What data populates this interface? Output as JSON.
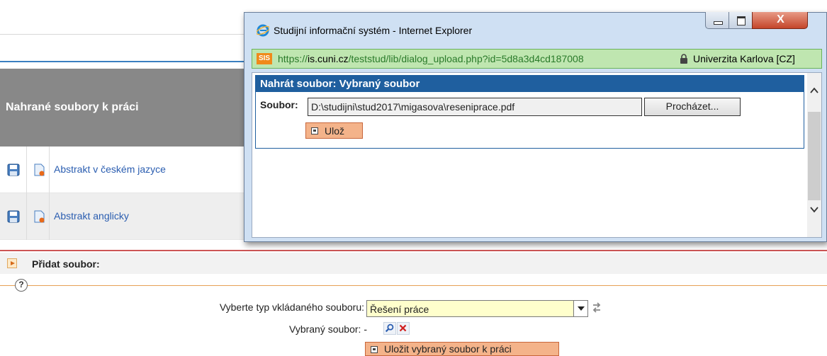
{
  "background": {
    "table_header": "Nahrané soubory k práci",
    "rows": [
      {
        "label": "Abstrakt v českém jazyce"
      },
      {
        "label": "Abstrakt anglicky"
      }
    ],
    "add_section": {
      "title": "Přidat soubor:",
      "help_symbol": "?"
    },
    "form": {
      "type_label": "Vyberte typ vkládaného souboru:",
      "type_value": "Řešení práce",
      "selected_label": "Vybraný soubor:",
      "selected_value": "-",
      "save_button": "Uložit vybraný soubor k práci"
    }
  },
  "popup": {
    "window_title": "Studijní informační systém - Internet Explorer",
    "close_symbol": "X",
    "address": {
      "badge": "SIS",
      "protocol": "https://",
      "domain": "is.cuni.cz",
      "path": "/teststud/lib/dialog_upload.php?id=5d8a3d4cd187008",
      "certificate": "Univerzita Karlova [CZ]"
    },
    "panel_title": "Nahrát soubor: Vybraný soubor",
    "file_label": "Soubor:",
    "file_value": "D:\\studijni\\stud2017\\migasova\\reseniprace.pdf",
    "browse_button": "Procházet...",
    "save_button": "Ulož"
  },
  "colors": {
    "panel_header": "#1f5f9f",
    "address_bg": "#bfe6b0",
    "button_orange": "#f4b38a",
    "select_bg": "#ffffcc"
  }
}
